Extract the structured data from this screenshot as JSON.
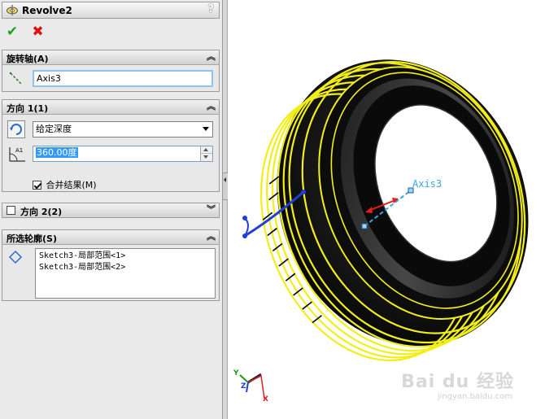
{
  "feature": {
    "title": "Revolve2",
    "help": "?",
    "ok_symbol": "✔",
    "cancel_symbol": "✖"
  },
  "axis_group": {
    "label": "旋转轴(A)",
    "collapse": "︽",
    "value": "Axis3"
  },
  "dir1_group": {
    "label": "方向 1(1)",
    "collapse": "︽",
    "end_condition": "给定深度",
    "angle": "360.00度",
    "merge_checked": true,
    "merge_label": "合并结果(M)"
  },
  "dir2_group": {
    "label": "方向 2(2)",
    "collapse": "︾",
    "checked": false
  },
  "contours_group": {
    "label": "所选轮廓(S)",
    "collapse": "︽",
    "items": [
      "Sketch3-局部范围<1>",
      "Sketch3-局部范围<2>"
    ]
  },
  "viewport": {
    "axis_label": "Axis3",
    "triad": {
      "x": "X",
      "y": "Y",
      "z": "Z"
    },
    "watermark": "Bai du 经验",
    "watermark_sub": "jingyan.baidu.com"
  },
  "colors": {
    "tire": "#111111",
    "highlight": "#f2ee1a",
    "sketch": "#1f3fd8",
    "axis": "#3aa6e0",
    "accent_red": "#e02020"
  }
}
